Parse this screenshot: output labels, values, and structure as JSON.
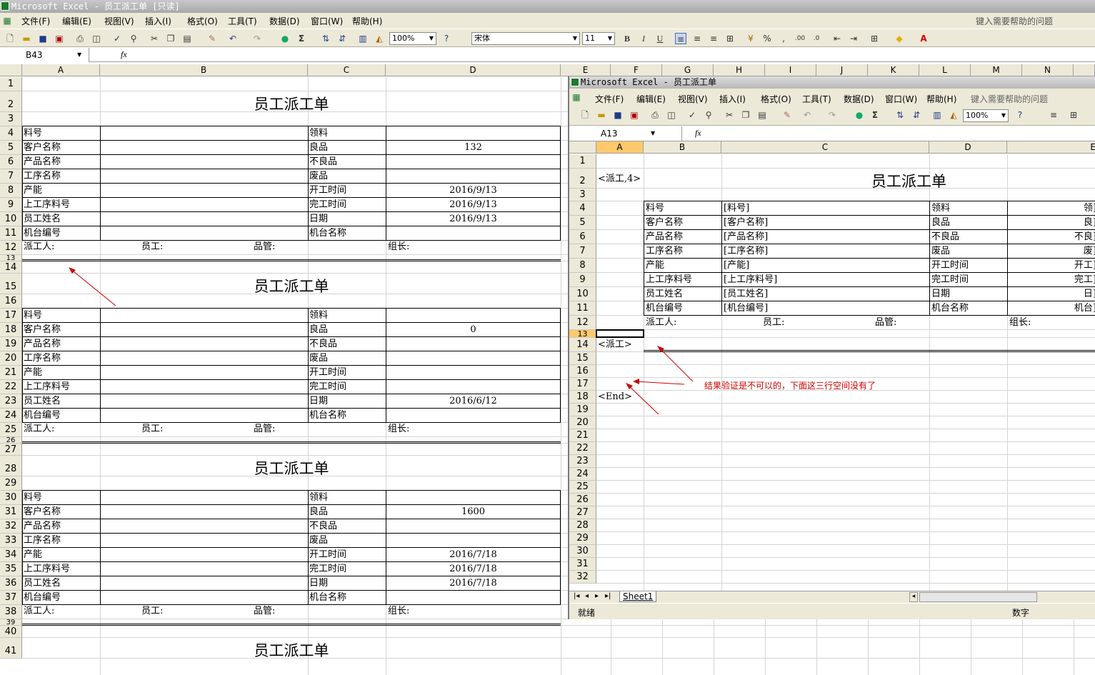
{
  "main_window": {
    "title": "Microsoft Excel - 员工派工单 [只读]",
    "menu": [
      "文件(F)",
      "编辑(E)",
      "视图(V)",
      "插入(I)",
      "格式(O)",
      "工具(T)",
      "数据(D)",
      "窗口(W)",
      "帮助(H)"
    ],
    "help_placeholder": "键入需要帮助的问题",
    "zoom": "100%",
    "font_name": "宋体",
    "font_size": "11",
    "name_box": "B43",
    "fx": "fx",
    "columns": [
      "A",
      "B",
      "C",
      "D",
      "E",
      "F",
      "G",
      "H",
      "I",
      "J",
      "K",
      "L",
      "M",
      "N"
    ],
    "rows": [
      "1",
      "2",
      "3",
      "4",
      "5",
      "6",
      "7",
      "8",
      "9",
      "10",
      "11",
      "12",
      "13",
      "14",
      "15",
      "16",
      "17",
      "18",
      "19",
      "20",
      "21",
      "22",
      "23",
      "24",
      "25",
      "26",
      "27",
      "28",
      "29",
      "30",
      "31",
      "32",
      "33",
      "34",
      "35",
      "36",
      "37",
      "38",
      "39",
      "40",
      "41"
    ]
  },
  "form_labels": {
    "title": "员工派工单",
    "left": [
      "料号",
      "客户名称",
      "产品名称",
      "工序名称",
      "产能",
      "上工序料号",
      "员工姓名",
      "机台编号"
    ],
    "mid": [
      "领料",
      "良品",
      "不良品",
      "废品",
      "开工时间",
      "完工时间",
      "日期",
      "机台名称"
    ],
    "footer": [
      "派工人:",
      "员工:",
      "品管:",
      "组长:"
    ]
  },
  "forms": [
    {
      "good": "132",
      "start": "2016/9/13",
      "finish": "2016/9/13",
      "date": "2016/9/13"
    },
    {
      "good": "0",
      "start": "",
      "finish": "",
      "date": "2016/6/12"
    },
    {
      "good": "1600",
      "start": "2016/7/18",
      "finish": "2016/7/18",
      "date": "2016/7/18"
    }
  ],
  "template_window": {
    "title": "Microsoft Excel - 员工派工单",
    "menu": [
      "文件(F)",
      "编辑(E)",
      "视图(V)",
      "插入(I)",
      "格式(O)",
      "工具(T)",
      "数据(D)",
      "窗口(W)",
      "帮助(H)"
    ],
    "help_placeholder": "键入需要帮助的问题",
    "zoom": "100%",
    "name_box": "A13",
    "fx": "fx",
    "columns": [
      "A",
      "B",
      "C",
      "D",
      "E"
    ],
    "rows": [
      "1",
      "2",
      "3",
      "4",
      "5",
      "6",
      "7",
      "8",
      "9",
      "10",
      "11",
      "12",
      "13",
      "14",
      "15",
      "16",
      "17",
      "18",
      "19",
      "20",
      "21",
      "22",
      "23",
      "24",
      "25",
      "26",
      "27",
      "28",
      "29",
      "30",
      "31",
      "32"
    ],
    "marker_start": "<派工,4>",
    "marker_row": "<派工>",
    "marker_end": "<End>",
    "placeholders_left": [
      "[料号]",
      "[客户名称]",
      "[产品名称]",
      "[工序名称]",
      "[产能]",
      "[上工序料号]",
      "[员工姓名]",
      "[机台编号]"
    ],
    "placeholders_right": [
      "[领",
      "[良",
      "[不良",
      "[废",
      "[开工",
      "[完工",
      "[日",
      "[机台"
    ],
    "sheet_tab": "Sheet1",
    "status_ready": "就绪",
    "status_num": "数字"
  },
  "annotation": "结果验证是不可以的，下面这三行空间没有了",
  "colors": {
    "chrome": "#ece9d8",
    "annotation": "#cc0000"
  }
}
